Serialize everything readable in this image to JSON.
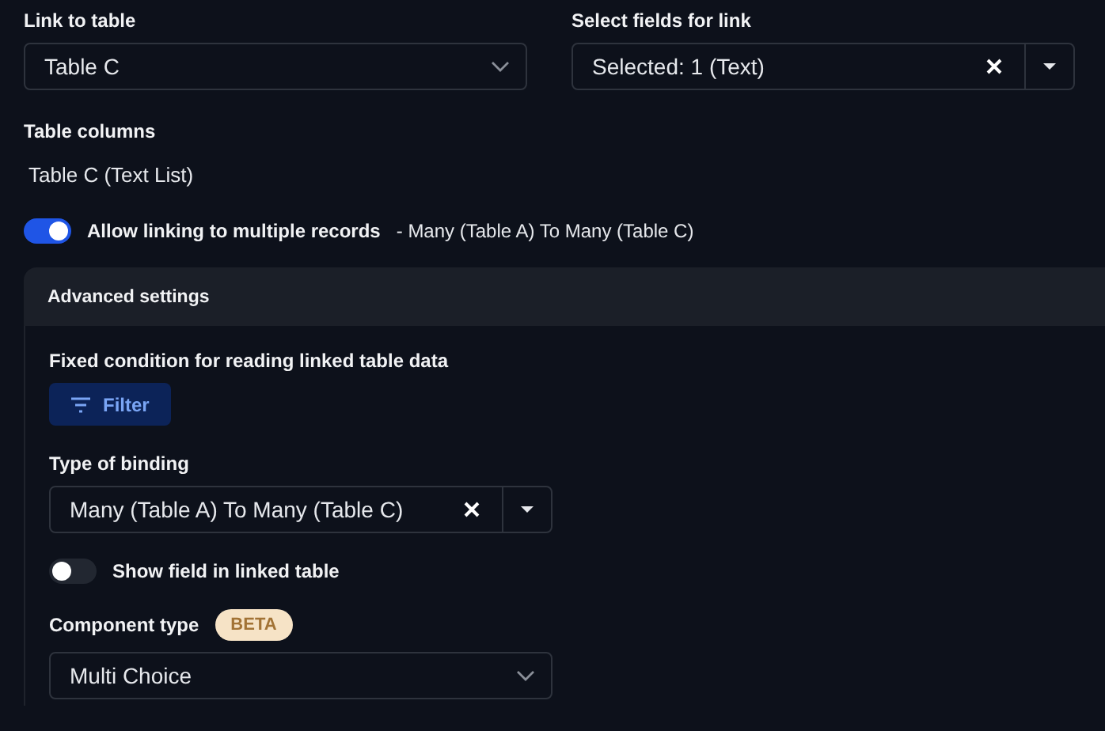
{
  "link_to_table": {
    "label": "Link to table",
    "kind": "select",
    "value": "Table C"
  },
  "select_fields": {
    "label": "Select fields for link",
    "kind": "clearable",
    "value": "Selected: 1 (Text)"
  },
  "table_columns": {
    "label": "Table columns",
    "value": "Table C (Text List)"
  },
  "allow_multiple": {
    "label": "Allow linking to multiple records",
    "note": "- Many (Table A) To Many (Table C)",
    "on": true
  },
  "advanced": {
    "title": "Advanced settings",
    "fixed_condition": {
      "label": "Fixed condition for reading linked table data",
      "button": "Filter"
    },
    "type_of_binding": {
      "label": "Type of binding",
      "kind": "clearable",
      "value": "Many (Table A) To Many (Table C)"
    },
    "show_field": {
      "label": "Show field in linked table",
      "on": false
    },
    "component_type": {
      "label": "Component type",
      "badge": "BETA",
      "kind": "select",
      "value": "Multi Choice"
    }
  }
}
